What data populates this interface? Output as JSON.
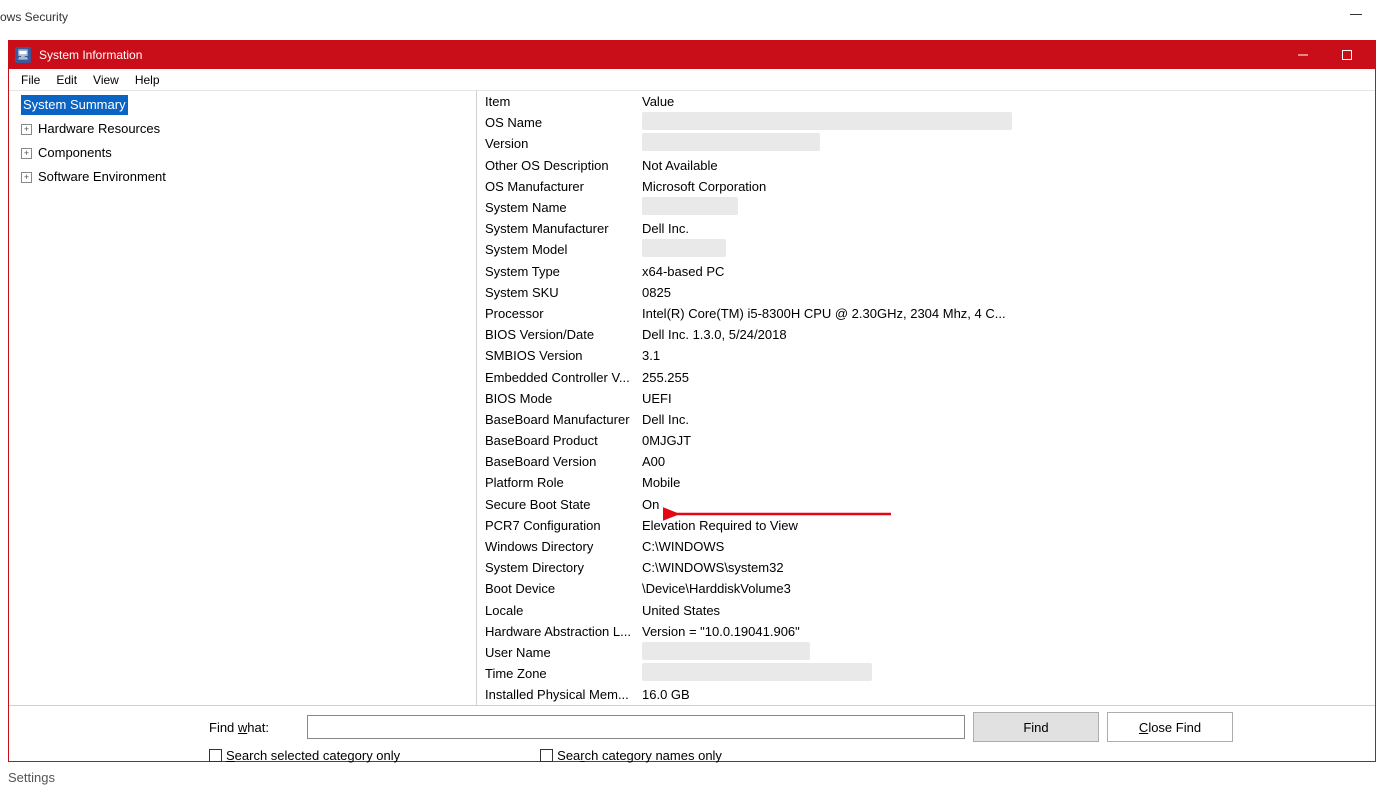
{
  "background": {
    "title_fragment": "ows Security",
    "settings_fragment": "Settings"
  },
  "window": {
    "title": "System Information",
    "menu": {
      "file": "File",
      "edit": "Edit",
      "view": "View",
      "help": "Help"
    }
  },
  "tree": {
    "root": "System Summary",
    "items": [
      "Hardware Resources",
      "Components",
      "Software Environment"
    ]
  },
  "details": {
    "header_item": "Item",
    "header_value": "Value",
    "rows": [
      {
        "item": "OS Name",
        "value": "",
        "redactedWidth": 370
      },
      {
        "item": "Version",
        "value": "",
        "redactedWidth": 178
      },
      {
        "item": "Other OS Description",
        "value": "Not Available"
      },
      {
        "item": "OS Manufacturer",
        "value": "Microsoft Corporation"
      },
      {
        "item": "System Name",
        "value": "",
        "redactedWidth": 96
      },
      {
        "item": "System Manufacturer",
        "value": "Dell Inc."
      },
      {
        "item": "System Model",
        "value": "",
        "redactedWidth": 84
      },
      {
        "item": "System Type",
        "value": "x64-based PC"
      },
      {
        "item": "System SKU",
        "value": "0825"
      },
      {
        "item": "Processor",
        "value": "Intel(R) Core(TM) i5-8300H CPU @ 2.30GHz, 2304 Mhz, 4 C..."
      },
      {
        "item": "BIOS Version/Date",
        "value": "Dell Inc. 1.3.0, 5/24/2018"
      },
      {
        "item": "SMBIOS Version",
        "value": "3.1"
      },
      {
        "item": "Embedded Controller V...",
        "value": "255.255"
      },
      {
        "item": "BIOS Mode",
        "value": "UEFI"
      },
      {
        "item": "BaseBoard Manufacturer",
        "value": "Dell Inc."
      },
      {
        "item": "BaseBoard Product",
        "value": "0MJGJT"
      },
      {
        "item": "BaseBoard Version",
        "value": "A00"
      },
      {
        "item": "Platform Role",
        "value": "Mobile"
      },
      {
        "item": "Secure Boot State",
        "value": "On"
      },
      {
        "item": "PCR7 Configuration",
        "value": "Elevation Required to View"
      },
      {
        "item": "Windows Directory",
        "value": "C:\\WINDOWS"
      },
      {
        "item": "System Directory",
        "value": "C:\\WINDOWS\\system32"
      },
      {
        "item": "Boot Device",
        "value": "\\Device\\HarddiskVolume3"
      },
      {
        "item": "Locale",
        "value": "United States"
      },
      {
        "item": "Hardware Abstraction L...",
        "value": "Version = \"10.0.19041.906\""
      },
      {
        "item": "User Name",
        "value": "",
        "redactedWidth": 168
      },
      {
        "item": "Time Zone",
        "value": "",
        "redactedWidth": 230
      },
      {
        "item": "Installed Physical Mem...",
        "value": "16.0 GB"
      }
    ]
  },
  "find": {
    "label": "Find what:",
    "find_button": "Find",
    "close_button": "Close Find",
    "check_selected": "Search selected category only",
    "check_names": "Search category names only"
  }
}
